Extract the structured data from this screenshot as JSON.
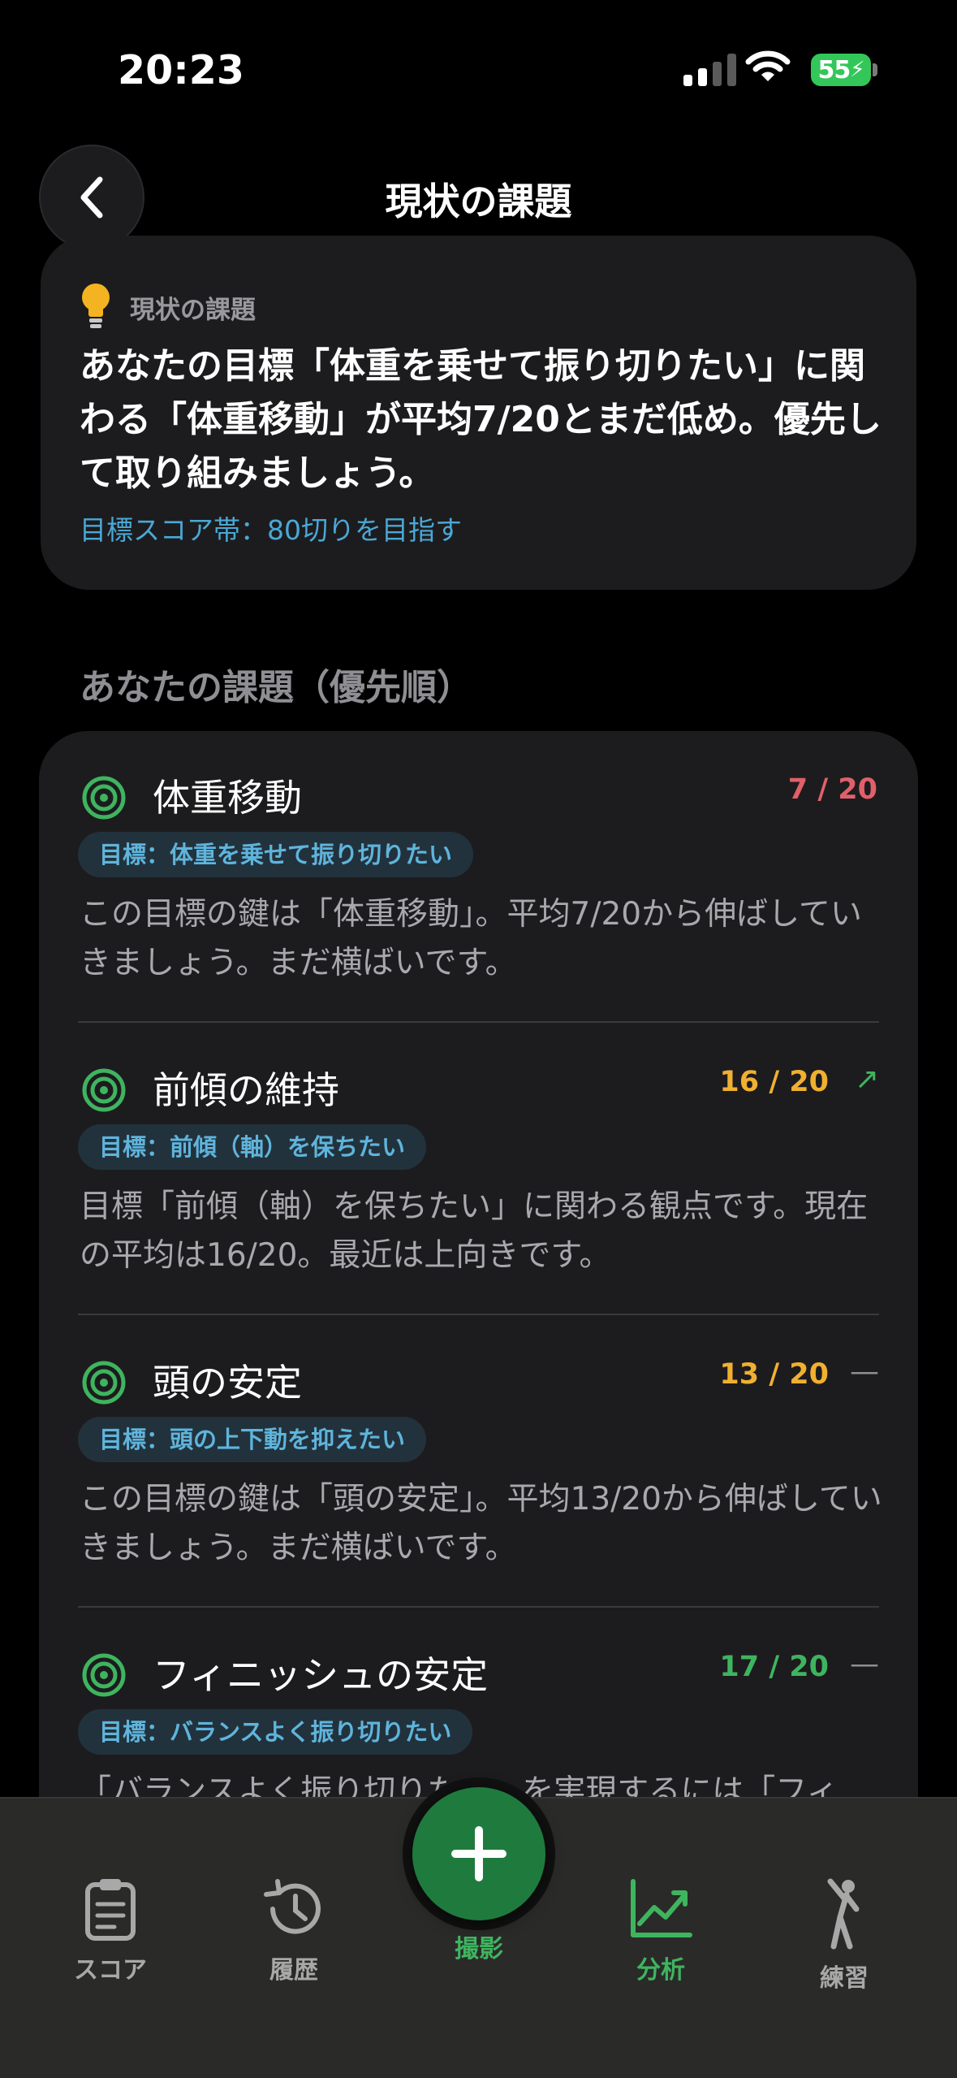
{
  "status_bar": {
    "time": "20:23",
    "battery": "55"
  },
  "nav": {
    "title": "現状の課題"
  },
  "issue_card": {
    "label": "現状の課題",
    "text": "あなたの目標「体重を乗せて振り切りたい」に関わる「体重移動」が平均7/20とまだ低め。優先して取り組みましょう。",
    "goal": "目標スコア帯：80切りを目指す"
  },
  "section_title": "あなたの課題（優先順）",
  "items": [
    {
      "name": "体重移動",
      "score": "7 / 20",
      "trend": "",
      "score_color": "#e0606a",
      "tag": "目標：体重を乗せて振り切りたい",
      "desc": "この目標の鍵は「体重移動」。平均7/20から伸ばしていきましょう。まだ横ばいです。"
    },
    {
      "name": "前傾の維持",
      "score": "16 / 20",
      "trend": "↗",
      "score_color": "#f0b030",
      "trend_color": "#3fb45f",
      "tag": "目標：前傾（軸）を保ちたい",
      "desc": "目標「前傾（軸）を保ちたい」に関わる観点です。現在の平均は16/20。最近は上向きです。"
    },
    {
      "name": "頭の安定",
      "score": "13 / 20",
      "trend": "—",
      "score_color": "#f0b030",
      "trend_color": "#8e8e93",
      "tag": "目標：頭の上下動を抑えたい",
      "desc": "この目標の鍵は「頭の安定」。平均13/20から伸ばしていきましょう。まだ横ばいです。"
    },
    {
      "name": "フィニッシュの安定",
      "score": "17 / 20",
      "trend": "—",
      "score_color": "#3fb45f",
      "trend_color": "#8e8e93",
      "tag": "目標：バランスよく振り切りたい",
      "desc": "「バランスよく振り切りたい」を実現するには「フィ"
    }
  ],
  "tabs": [
    {
      "label": "スコア",
      "icon": "clipboard-icon"
    },
    {
      "label": "履歴",
      "icon": "history-icon"
    },
    {
      "label": "撮影",
      "icon": "plus-icon"
    },
    {
      "label": "分析",
      "icon": "chart-icon"
    },
    {
      "label": "練習",
      "icon": "golfer-icon"
    }
  ],
  "colors": {
    "accent_green": "#3fb45f",
    "fab": "#1f7a3e",
    "tag_text": "#5fb4dc"
  }
}
